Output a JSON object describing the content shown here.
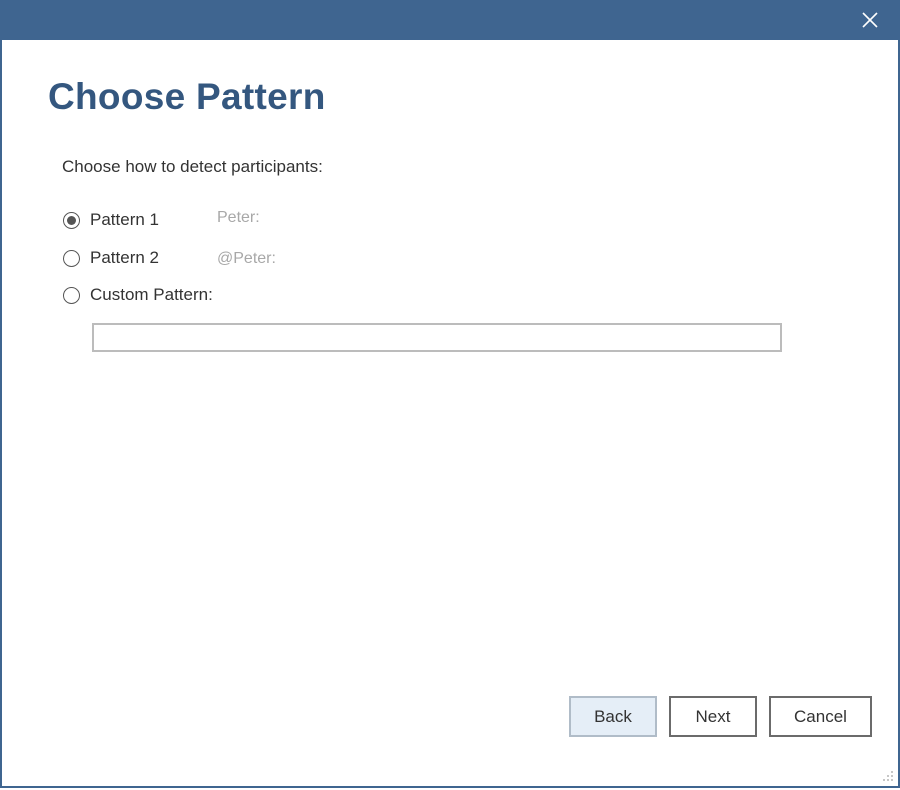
{
  "window": {
    "title_bar_color": "#3f6590",
    "close_icon": "close-icon"
  },
  "page": {
    "title": "Choose Pattern",
    "instruction": "Choose how to detect participants:"
  },
  "options": [
    {
      "label": "Pattern 1",
      "example": "Peter:",
      "selected": true
    },
    {
      "label": "Pattern 2",
      "example": "@Peter:",
      "selected": false
    },
    {
      "label": "Custom Pattern:",
      "selected": false
    }
  ],
  "custom_pattern": {
    "value": ""
  },
  "buttons": {
    "back": "Back",
    "next": "Next",
    "cancel": "Cancel"
  },
  "colors": {
    "accent": "#3f6590",
    "title_text": "#34577f",
    "example_text": "#a8a8a8"
  }
}
